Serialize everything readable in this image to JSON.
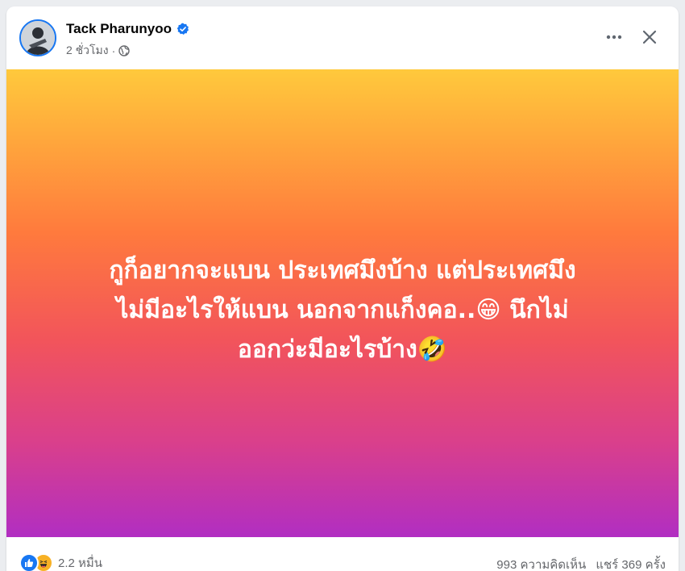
{
  "post": {
    "author": "Tack Pharunyoo",
    "verified_icon": "verified-badge-icon",
    "time": "2 ชั่วโมง",
    "separator": "·",
    "audience_icon": "globe-icon",
    "text": "กูก็อยากจะแบน ประเทศมึงบ้าง แต่ประเทศมึง\nไม่มีอะไรให้แบน นอกจากแก็งคอ..😁 นึกไม่\nออกว่ะมีอะไรบ้าง🤣",
    "background_gradient": [
      "#ffc93c",
      "#ff7a3d",
      "#f2545b",
      "#d93f8c",
      "#b12ec2"
    ]
  },
  "footer": {
    "reaction_icons": [
      "like-icon",
      "haha-icon"
    ],
    "reaction_count": "2.2 หมื่น",
    "comments": "993 ความคิดเห็น",
    "shares": "แชร์ 369 ครั้ง"
  },
  "colors": {
    "accent": "#1877f2",
    "text_primary": "#050505",
    "text_secondary": "#65676b"
  }
}
